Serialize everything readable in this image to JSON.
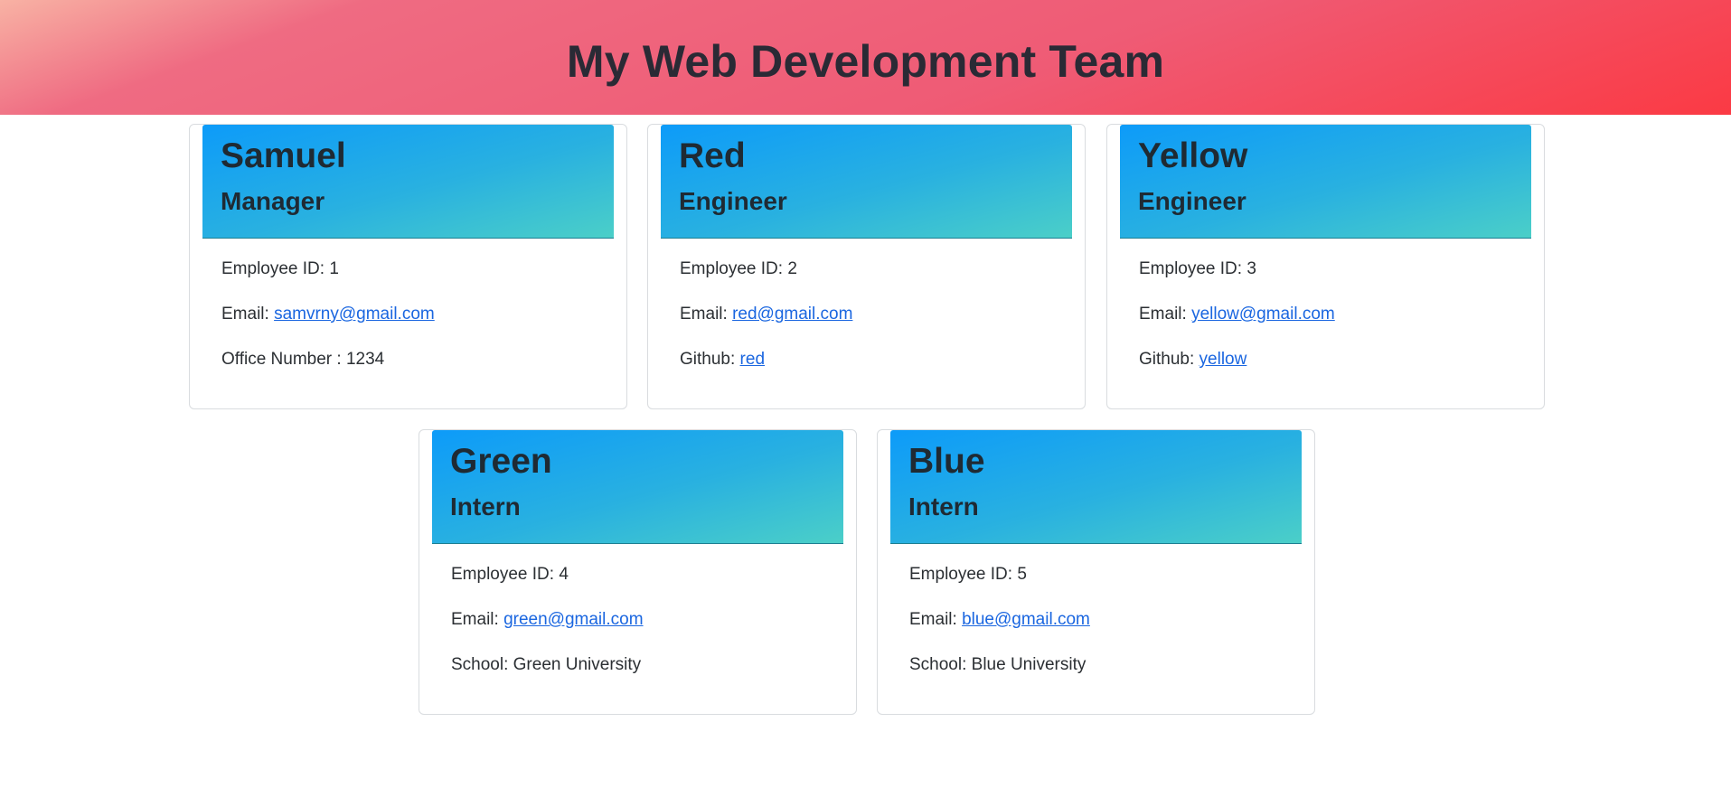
{
  "header": {
    "title": "My Web Development Team"
  },
  "team": [
    {
      "name": "Samuel",
      "role": "Manager",
      "id_label": "Employee ID: ",
      "id": "1",
      "email_label": "Email: ",
      "email": "samvrny@gmail.com",
      "extra_label": "Office Number : ",
      "extra_value": "1234"
    },
    {
      "name": "Red",
      "role": "Engineer",
      "id_label": "Employee ID: ",
      "id": "2",
      "email_label": "Email: ",
      "email": "red@gmail.com",
      "extra_label": "Github: ",
      "extra_value": "red"
    },
    {
      "name": "Yellow",
      "role": "Engineer",
      "id_label": "Employee ID: ",
      "id": "3",
      "email_label": "Email: ",
      "email": "yellow@gmail.com",
      "extra_label": "Github: ",
      "extra_value": "yellow"
    },
    {
      "name": "Green",
      "role": "Intern",
      "id_label": "Employee ID: ",
      "id": "4",
      "email_label": "Email: ",
      "email": "green@gmail.com",
      "extra_label": "School: ",
      "extra_value": "Green University"
    },
    {
      "name": "Blue",
      "role": "Intern",
      "id_label": "Employee ID: ",
      "id": "5",
      "email_label": "Email: ",
      "email": "blue@gmail.com",
      "extra_label": "School: ",
      "extra_value": "Blue University"
    }
  ],
  "colors": {
    "header_gradient_start": "#f8b2a4",
    "header_gradient_end": "#fb3a44",
    "card_header_start": "#0d9bf9",
    "card_header_end": "#4bcfc8",
    "link": "#1a66e0"
  }
}
